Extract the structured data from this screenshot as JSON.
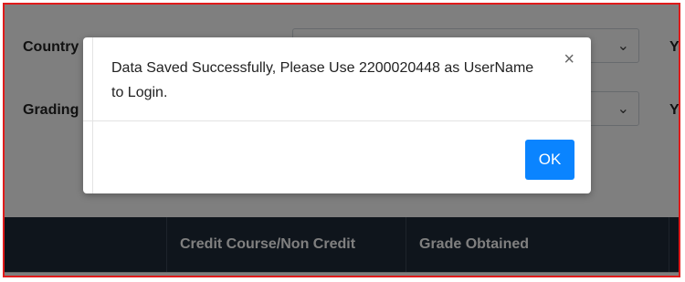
{
  "form": {
    "country_label": "Country",
    "grading_label": "Grading",
    "year_label_1": "Ye",
    "year_label_2": "Ye"
  },
  "table": {
    "headers": [
      "",
      "Credit Course/Non Credit",
      "Grade Obtained",
      ""
    ]
  },
  "modal": {
    "message": "Data Saved Successfully, Please Use 2200020448 as UserName to Login.",
    "close_symbol": "×",
    "ok_label": "OK"
  },
  "colors": {
    "frame_border": "#e01b1b",
    "table_header_bg": "#1f2a38",
    "ok_button": "#0a84ff"
  }
}
